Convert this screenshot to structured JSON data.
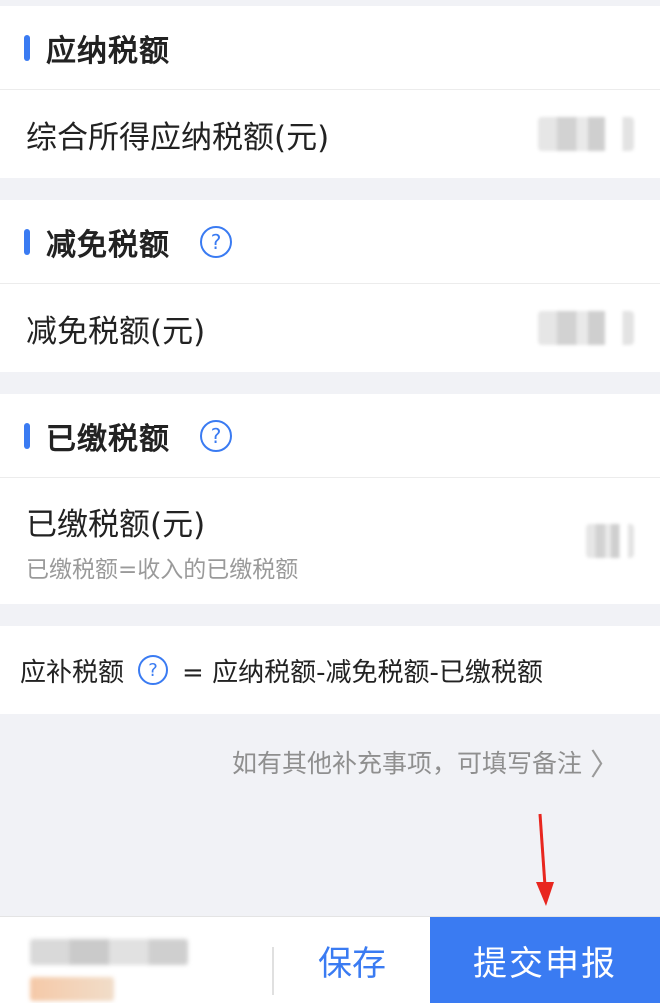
{
  "sections": {
    "payable": {
      "title": "应纳税额",
      "row_label": "综合所得应纳税额(元)"
    },
    "relief": {
      "title": "减免税额",
      "row_label": "减免税额(元)"
    },
    "paid": {
      "title": "已缴税额",
      "row_label": "已缴税额(元)",
      "row_hint": "已缴税额=收入的已缴税额"
    }
  },
  "formula": {
    "label": "应补税额",
    "expression": "= 应纳税额-减免税额-已缴税额"
  },
  "remark": {
    "text": "如有其他补充事项，可填写备注"
  },
  "bottom_bar": {
    "save_label": "保存",
    "submit_label": "提交申报"
  },
  "icons": {
    "help": "?",
    "chevron": "〉"
  },
  "colors": {
    "accent": "#3a7bf2",
    "annotation_arrow": "#e8261f"
  }
}
